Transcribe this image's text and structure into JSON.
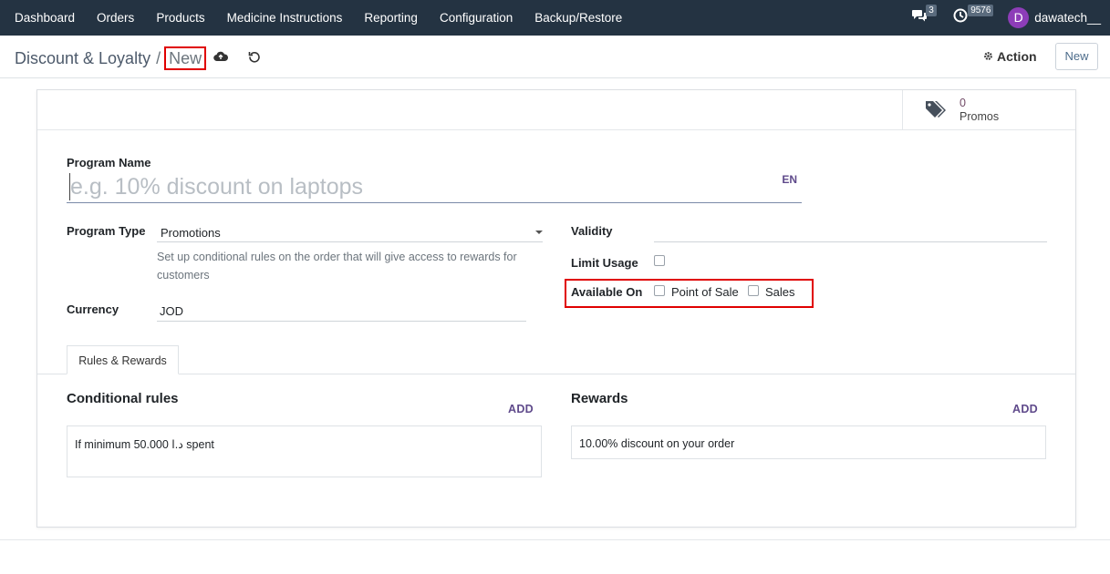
{
  "navbar": {
    "items": [
      "Dashboard",
      "Orders",
      "Products",
      "Medicine Instructions",
      "Reporting",
      "Configuration",
      "Backup/Restore"
    ],
    "messages_count": "3",
    "activities_count": "9576",
    "avatar_letter": "D",
    "username": "dawatech__"
  },
  "control_panel": {
    "breadcrumb_parent": "Discount & Loyalty",
    "breadcrumb_separator": "/",
    "breadcrumb_current": "New",
    "action_label": "Action",
    "new_label": "New"
  },
  "smart_button": {
    "value": "0",
    "label": "Promos"
  },
  "form": {
    "program_name_label": "Program Name",
    "program_name_placeholder": "e.g. 10% discount on laptops",
    "lang_tag": "EN",
    "program_type_label": "Program Type",
    "program_type_value": "Promotions",
    "program_type_help": "Set up conditional rules on the order that will give access to rewards for customers",
    "currency_label": "Currency",
    "currency_value": "JOD",
    "validity_label": "Validity",
    "limit_usage_label": "Limit Usage",
    "available_on_label": "Available On",
    "available_on_options": [
      "Point of Sale",
      "Sales"
    ]
  },
  "tabs": [
    "Rules & Rewards"
  ],
  "rules": {
    "title": "Conditional rules",
    "add_label": "ADD",
    "items": [
      "If minimum 50.000  د.ا spent"
    ]
  },
  "rewards": {
    "title": "Rewards",
    "add_label": "ADD",
    "items": [
      "10.00% discount on your order"
    ]
  }
}
